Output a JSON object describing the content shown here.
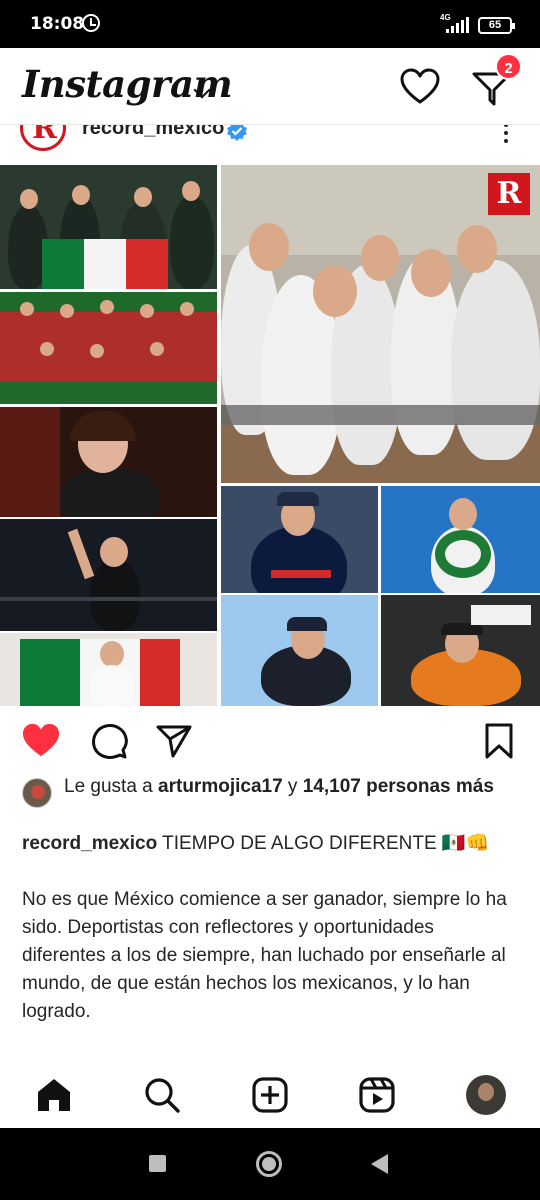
{
  "status_bar": {
    "time": "18:08",
    "network": "4G",
    "battery": "65"
  },
  "header": {
    "logo": "Instagram",
    "notification_count": "2",
    "icons": [
      "chevron-down-icon",
      "heart-icon",
      "filter-icon"
    ]
  },
  "post": {
    "username": "record_mexico",
    "brand_mark": "R",
    "likes": {
      "prefix": "Le gusta a ",
      "user": "arturmojica17",
      "middle": " y ",
      "count": "14,107 personas más"
    },
    "caption": {
      "user": "record_mexico",
      "headline": " TIEMPO DE ALGO DIFERENTE 🇲🇽👊",
      "body": "No es que México comience a ser ganador, siempre lo ha sido. Deportistas con reflectores y oportunidades diferentes a los de siempre, han luchado por enseñarle al mundo, de que están hechos los mexicanos, y lo han logrado."
    },
    "liked": true,
    "colors": {
      "like": "#ff3040",
      "badge": "#ff3040",
      "brand": "#d2161e"
    }
  },
  "bottom_nav": {
    "items": [
      "home-icon",
      "search-icon",
      "create-icon",
      "reels-icon",
      "profile-avatar"
    ]
  }
}
